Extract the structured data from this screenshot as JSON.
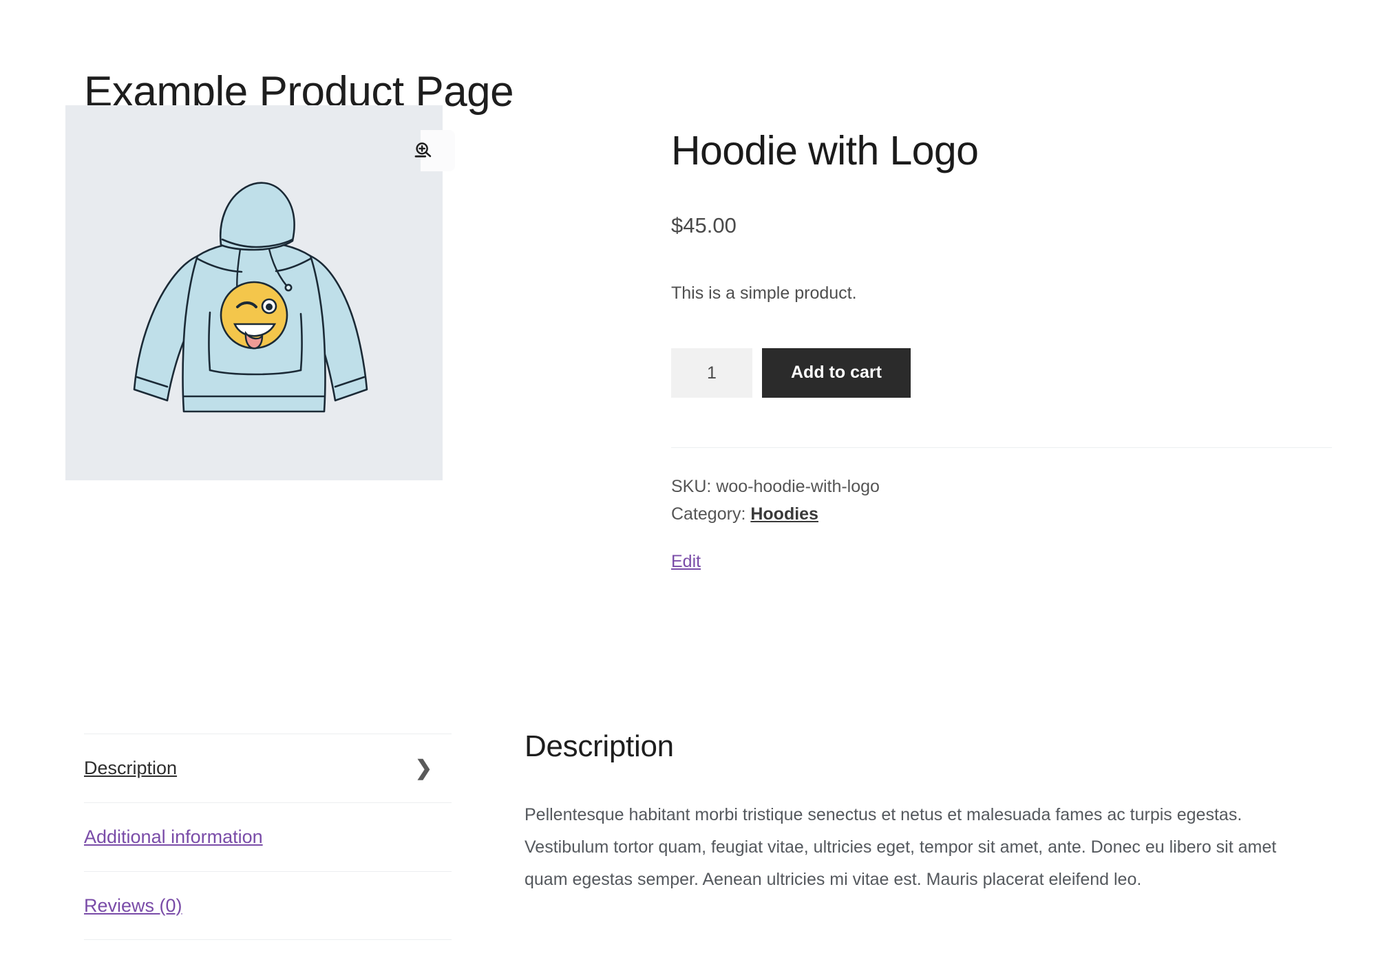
{
  "page": {
    "title": "Example Product Page"
  },
  "gallery": {
    "zoom_icon": "magnifier-plus-icon",
    "product_image_alt": "Light blue hoodie with winking emoji logo",
    "background_color": "#e8ebef",
    "hoodie_color": "#bfdfe9",
    "hoodie_outline_color": "#1b2a36",
    "emoji_color": "#f4c64b"
  },
  "product": {
    "name": "Hoodie with Logo",
    "price": "$45.00",
    "short_description": "This is a simple product.",
    "quantity": "1",
    "add_to_cart_label": "Add to cart",
    "sku_label": "SKU:",
    "sku_value": "woo-hoodie-with-logo",
    "category_label": "Category:",
    "category_value": "Hoodies",
    "edit_label": "Edit"
  },
  "tabs": [
    {
      "label": "Description",
      "active": true,
      "chevron": "❯"
    },
    {
      "label": "Additional information",
      "active": false
    },
    {
      "label": "Reviews (0)",
      "active": false
    }
  ],
  "panel": {
    "title": "Description",
    "body": "Pellentesque habitant morbi tristique senectus et netus et malesuada fames ac turpis egestas. Vestibulum tortor quam, feugiat vitae, ultricies eget, tempor sit amet, ante. Donec eu libero sit amet quam egestas semper. Aenean ultricies mi vitae est. Mauris placerat eleifend leo."
  },
  "colors": {
    "accent_link": "#7a4ca8",
    "button_bg": "#2b2b2b",
    "text": "#3c3c3c",
    "divider": "#eceef0"
  }
}
